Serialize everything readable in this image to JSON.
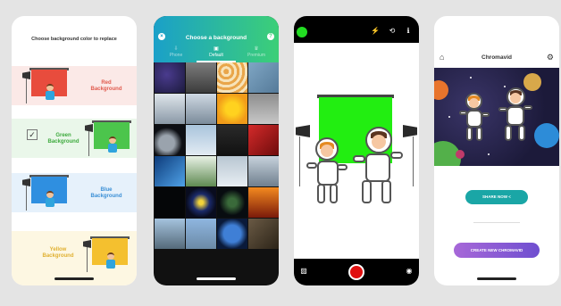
{
  "screen1": {
    "title": "Choose background color to replace",
    "options": [
      {
        "line1": "Red",
        "line2": "Background",
        "color": "#e84c3d",
        "text_color": "#e05a4d",
        "bg": "#fbe9e7"
      },
      {
        "line1": "Green",
        "line2": "Background",
        "color": "#4cc54c",
        "text_color": "#3daa3d",
        "bg": "#eaf7ea",
        "selected": true
      },
      {
        "line1": "Blue",
        "line2": "Background",
        "color": "#2f8fe0",
        "text_color": "#3a8fd6",
        "bg": "#e6f1fb"
      },
      {
        "line1": "Yellow",
        "line2": "Background",
        "color": "#f4c02f",
        "text_color": "#e0b030",
        "bg": "#fdf7e2"
      }
    ],
    "check_glyph": "✓"
  },
  "screen2": {
    "title": "Choose a background",
    "tabs": [
      {
        "label": "Phone",
        "icon": "phone-icon",
        "glyph": "⇩"
      },
      {
        "label": "Default",
        "icon": "gallery-icon",
        "glyph": "▣",
        "active": true
      },
      {
        "label": "Premium",
        "icon": "crown-icon",
        "glyph": "♛"
      }
    ],
    "close_glyph": "×",
    "help_glyph": "?"
  },
  "screen3": {
    "top_icons": [
      {
        "name": "flash-off-icon",
        "glyph": "⚡"
      },
      {
        "name": "switch-camera-icon",
        "glyph": "⟲"
      },
      {
        "name": "info-icon",
        "glyph": "ℹ"
      }
    ],
    "bottom_icons": [
      {
        "name": "gallery-icon",
        "glyph": "▨"
      },
      {
        "name": "camera-icon",
        "glyph": "◉"
      }
    ]
  },
  "screen4": {
    "title": "Chromavid",
    "share_button": "SHARE NOW <",
    "create_button": "CREATE NEW CHROMAVID",
    "home_glyph": "⌂",
    "settings_glyph": "⚙"
  }
}
